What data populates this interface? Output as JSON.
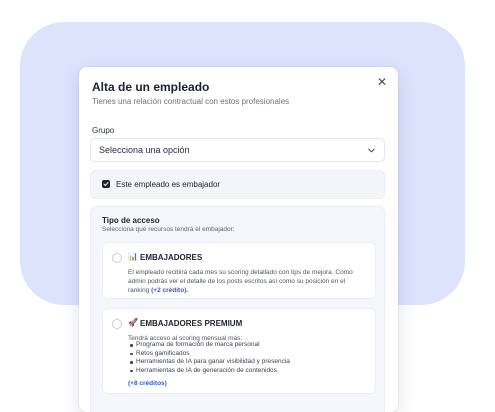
{
  "modal": {
    "title": "Alta de un empleado",
    "subtitle": "Tienes una relación contractual con estos profesionales",
    "close_icon": "close-icon"
  },
  "group": {
    "label": "Grupo",
    "placeholder": "Selecciona una opción",
    "icon": "chevron-down-icon"
  },
  "ambassador": {
    "checked": true,
    "label": "Este empleado es embajador"
  },
  "access": {
    "title": "Tipo de acceso",
    "subtitle": "Selecciona qué recursos tendrá el embajador:",
    "options": [
      {
        "icon": "📊",
        "icon_name": "bar-chart-icon",
        "title": "EMBAJADORES",
        "description": "El empleado recibirá cada mes su scoring detallado con tips de mejora. Como admin podrás ver el detalle de los posts escritos así como su posición en el ranking",
        "credits": "(+2 crédito)."
      },
      {
        "icon": "🚀",
        "icon_name": "rocket-icon",
        "title": "EMBAJADORES PREMIUM",
        "description": "Tendrá acceso al scoring mensual más:",
        "features": [
          "Programa de formación de marca personal",
          "Retos gamificados",
          "Herramientas de IA para ganar visibilidad y presencia",
          "Herramientas de IA de generación de contenidos"
        ],
        "credits": "(+8 créditos)"
      }
    ]
  },
  "colors": {
    "background_blob": "#dde3fb",
    "link": "#3557c9",
    "checkbox": "#1f2330"
  }
}
